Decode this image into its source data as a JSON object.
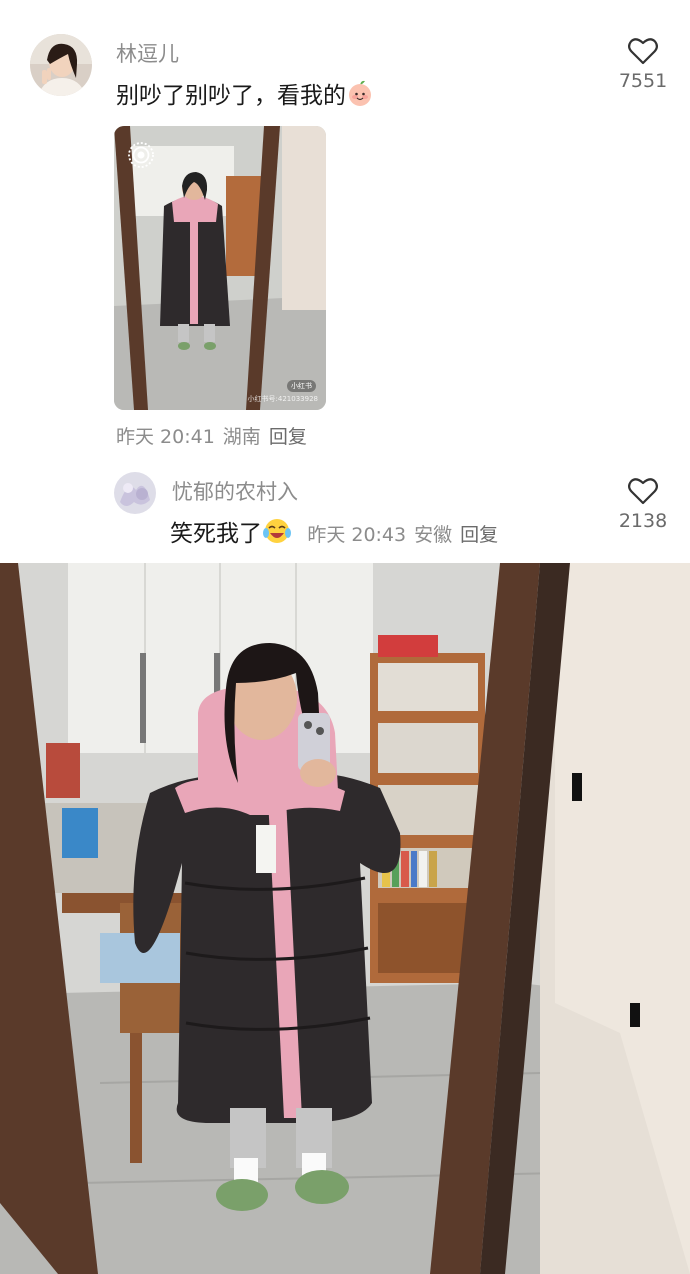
{
  "comment": {
    "username": "林逗儿",
    "text": "别吵了别吵了，看我的",
    "emoji": "peach-smile-icon",
    "likes": "7551",
    "time": "昨天 20:41",
    "location": "湖南",
    "reply_label": "回复",
    "image_badge": "小红书",
    "image_watermark": "小红书号:421033928"
  },
  "reply": {
    "username": "忧郁的农村入",
    "text": "笑死我了",
    "emoji": "laugh-cry-icon",
    "time": "昨天 20:43",
    "location": "安徽",
    "reply_label": "回复",
    "likes": "2138"
  },
  "colors": {
    "jacket_black": "#2e2a2c",
    "jacket_pink": "#e9a6b8",
    "mirror_frame": "#5a3a2a",
    "slipper_green": "#7aa06a"
  }
}
